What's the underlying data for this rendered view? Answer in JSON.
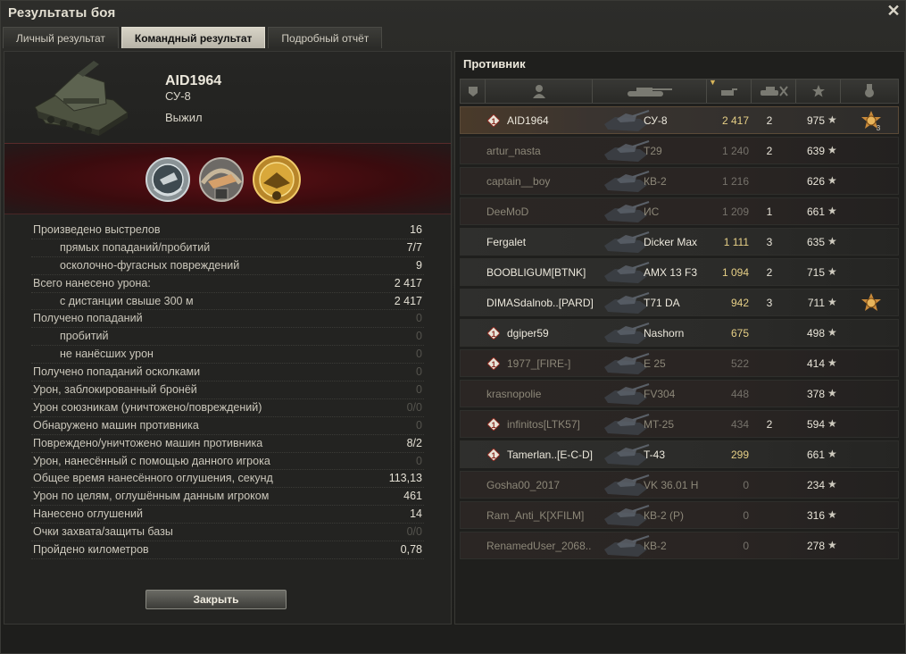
{
  "window": {
    "title": "Результаты боя"
  },
  "tabs": [
    {
      "label": "Личный результат",
      "active": false
    },
    {
      "label": "Командный результат",
      "active": true
    },
    {
      "label": "Подробный отчёт",
      "active": false
    }
  ],
  "player": {
    "name": "AID1964",
    "vehicle": "СУ-8",
    "status": "Выжил"
  },
  "medals": [
    "medal-icon",
    "medal-icon",
    "medal-icon"
  ],
  "stats": [
    {
      "label": "Произведено выстрелов",
      "value": "16",
      "indent": 0,
      "dim": false
    },
    {
      "label": "прямых попаданий/пробитий",
      "value": "7/7",
      "indent": 1,
      "dim": false
    },
    {
      "label": "осколочно-фугасных повреждений",
      "value": "9",
      "indent": 1,
      "dim": false
    },
    {
      "label": "Всего нанесено урона:",
      "value": "2 417",
      "indent": 0,
      "dim": false
    },
    {
      "label": "с дистанции свыше 300 м",
      "value": "2 417",
      "indent": 1,
      "dim": false
    },
    {
      "label": "Получено попаданий",
      "value": "0",
      "indent": 0,
      "dim": true
    },
    {
      "label": "пробитий",
      "value": "0",
      "indent": 1,
      "dim": true
    },
    {
      "label": "не нанёсших урон",
      "value": "0",
      "indent": 1,
      "dim": true
    },
    {
      "label": "Получено попаданий осколками",
      "value": "0",
      "indent": 0,
      "dim": true
    },
    {
      "label": "Урон, заблокированный бронёй",
      "value": "0",
      "indent": 0,
      "dim": true
    },
    {
      "label": "Урон союзникам (уничтожено/повреждений)",
      "value": "0/0",
      "indent": 0,
      "dim": true
    },
    {
      "label": "Обнаружено машин противника",
      "value": "0",
      "indent": 0,
      "dim": true
    },
    {
      "label": "Повреждено/уничтожено машин противника",
      "value": "8/2",
      "indent": 0,
      "dim": false
    },
    {
      "label": "Урон, нанесённый с помощью данного игрока",
      "value": "0",
      "indent": 0,
      "dim": true
    },
    {
      "label": "Общее время нанесённого оглушения, секунд",
      "value": "113,13",
      "indent": 0,
      "dim": false
    },
    {
      "label": "Урон по целям, оглушённым данным игроком",
      "value": "461",
      "indent": 0,
      "dim": false
    },
    {
      "label": "Нанесено оглушений",
      "value": "14",
      "indent": 0,
      "dim": false
    },
    {
      "label": "Очки захвата/защиты базы",
      "value": "0/0",
      "indent": 0,
      "dim": true
    },
    {
      "label": "Пройдено километров",
      "value": "0,78",
      "indent": 0,
      "dim": false
    }
  ],
  "close_button": {
    "label": "Закрыть"
  },
  "team": {
    "title": "Противник",
    "columns": [
      "platoon-icon",
      "player-icon",
      "vehicle-icon",
      "damage-icon",
      "kills-icon",
      "xp-star-icon",
      "medal-icon"
    ],
    "players": [
      {
        "name": "AID1964",
        "vehicle": "СУ-8",
        "damage": "2 417",
        "kills": "2",
        "xp": "975",
        "platoon": true,
        "alive": true,
        "self": true,
        "medal": true,
        "medal_count": "3"
      },
      {
        "name": "artur_nasta",
        "vehicle": "T29",
        "damage": "1 240",
        "kills": "2",
        "xp": "639",
        "platoon": false,
        "alive": false,
        "self": false,
        "medal": false
      },
      {
        "name": "captain__boy",
        "vehicle": "КВ-2",
        "damage": "1 216",
        "kills": "",
        "xp": "626",
        "platoon": false,
        "alive": false,
        "self": false,
        "medal": false
      },
      {
        "name": "DeeMoD",
        "vehicle": "ИС",
        "damage": "1 209",
        "kills": "1",
        "xp": "661",
        "platoon": false,
        "alive": false,
        "self": false,
        "medal": false
      },
      {
        "name": "Fergalet",
        "vehicle": "Dicker Max",
        "damage": "1 111",
        "kills": "3",
        "xp": "635",
        "platoon": false,
        "alive": true,
        "self": false,
        "medal": false
      },
      {
        "name": "BOOBLIGUM[BTNK]",
        "vehicle": "AMX 13 F3",
        "damage": "1 094",
        "kills": "2",
        "xp": "715",
        "platoon": false,
        "alive": true,
        "self": false,
        "medal": false
      },
      {
        "name": "DIMASdalnob..[PARD]",
        "vehicle": "T71 DA",
        "damage": "942",
        "kills": "3",
        "xp": "711",
        "platoon": false,
        "alive": true,
        "self": false,
        "medal": true,
        "medal_count": ""
      },
      {
        "name": "dgiper59",
        "vehicle": "Nashorn",
        "damage": "675",
        "kills": "",
        "xp": "498",
        "platoon": true,
        "alive": true,
        "self": false,
        "medal": false
      },
      {
        "name": "1977_[FIRE-]",
        "vehicle": "E 25",
        "damage": "522",
        "kills": "",
        "xp": "414",
        "platoon": true,
        "alive": false,
        "self": false,
        "medal": false
      },
      {
        "name": "krasnopolie",
        "vehicle": "FV304",
        "damage": "448",
        "kills": "",
        "xp": "378",
        "platoon": false,
        "alive": false,
        "self": false,
        "medal": false
      },
      {
        "name": "infinitos[LTK57]",
        "vehicle": "MT-25",
        "damage": "434",
        "kills": "2",
        "xp": "594",
        "platoon": true,
        "alive": false,
        "self": false,
        "medal": false
      },
      {
        "name": "Tamerlan..[E-C-D]",
        "vehicle": "T-43",
        "damage": "299",
        "kills": "",
        "xp": "661",
        "platoon": true,
        "alive": true,
        "self": false,
        "medal": false
      },
      {
        "name": "Gosha00_2017",
        "vehicle": "VK 36.01 H",
        "damage": "0",
        "kills": "",
        "xp": "234",
        "platoon": false,
        "alive": false,
        "self": false,
        "medal": false
      },
      {
        "name": "Ram_Anti_K[XFILM]",
        "vehicle": "КВ-2 (Р)",
        "damage": "0",
        "kills": "",
        "xp": "316",
        "platoon": false,
        "alive": false,
        "self": false,
        "medal": false
      },
      {
        "name": "RenamedUser_2068..",
        "vehicle": "КВ-2",
        "damage": "0",
        "kills": "",
        "xp": "278",
        "platoon": false,
        "alive": false,
        "self": false,
        "medal": false
      }
    ]
  },
  "colors": {
    "damage_alive": "#e6cf86",
    "damage_dead": "#75716a",
    "medal_band": "#5a0f14"
  }
}
